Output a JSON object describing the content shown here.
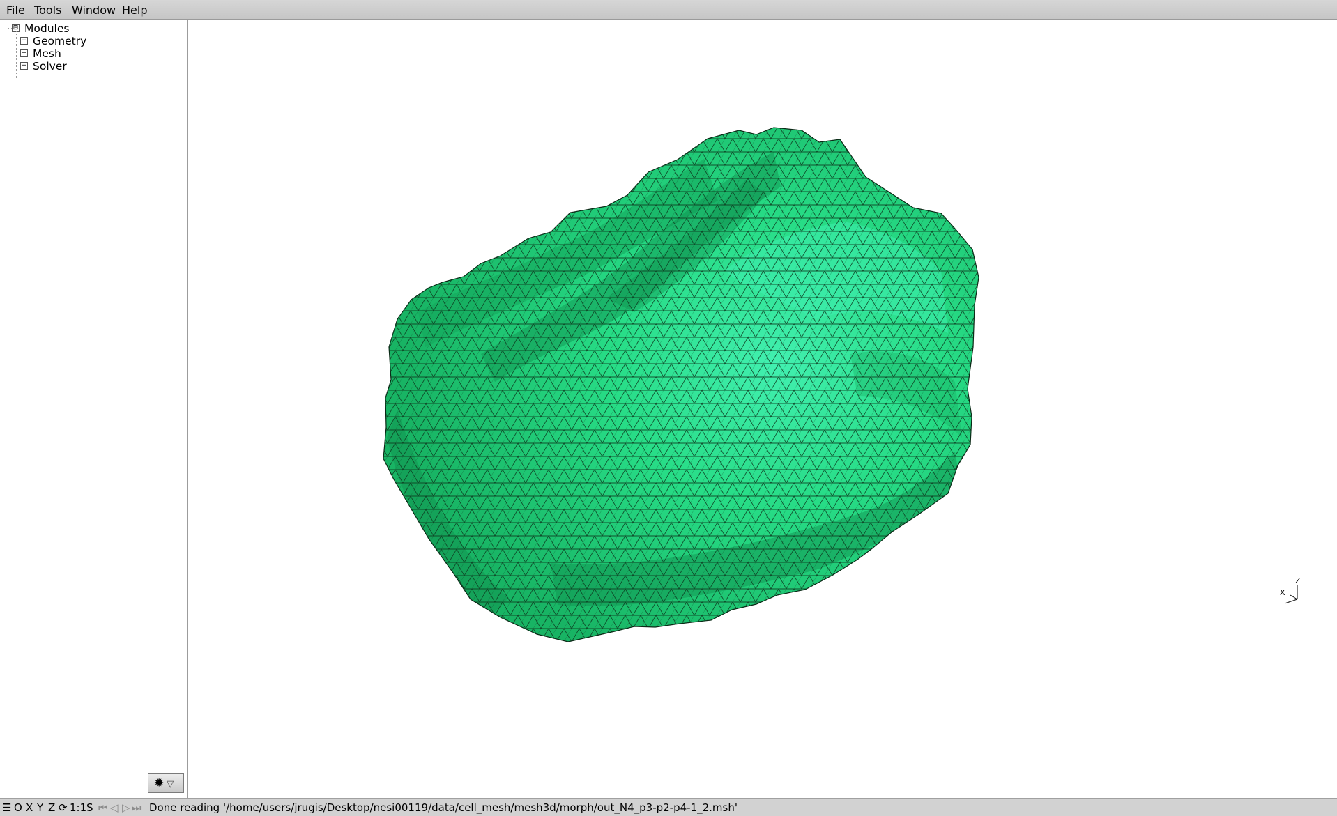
{
  "menu": {
    "file": {
      "accel": "F",
      "rest": "ile"
    },
    "tools": {
      "accel": "T",
      "rest": "ools"
    },
    "window": {
      "accel": "W",
      "rest": "indow"
    },
    "help": {
      "accel": "H",
      "rest": "elp"
    }
  },
  "tree": {
    "root": {
      "label": "Modules",
      "expander": "⊟"
    },
    "children": [
      {
        "label": "Geometry",
        "expander": "+"
      },
      {
        "label": "Mesh",
        "expander": "+"
      },
      {
        "label": "Solver",
        "expander": "+"
      }
    ]
  },
  "options_button": {
    "icon": "gear-icon",
    "glyph": "✹",
    "arrow": "▽"
  },
  "statusbar": {
    "menu_glyph": "☰",
    "o": "O",
    "x": "X",
    "y": "Y",
    "z": "Z",
    "rotate_glyph": "⟳",
    "scale": "1:1",
    "s": "S",
    "first_glyph": "⏮",
    "prev_glyph": "◁",
    "play_glyph": "▷",
    "last_glyph": "⏭",
    "message": "Done reading '/home/users/jrugis/Desktop/nesi00119/data/cell_mesh/mesh3d/morph/out_N4_p3-p2-p4-1_2.msh'"
  },
  "axes": {
    "x": "X",
    "z": "Z"
  },
  "colors": {
    "mesh_fill": "#22d47c",
    "mesh_light": "#35eba4",
    "mesh_dark": "#14a55b",
    "mesh_edge": "#0a2a16",
    "menubar": "#c8c8c8",
    "statusbar": "#d2d2d2"
  }
}
